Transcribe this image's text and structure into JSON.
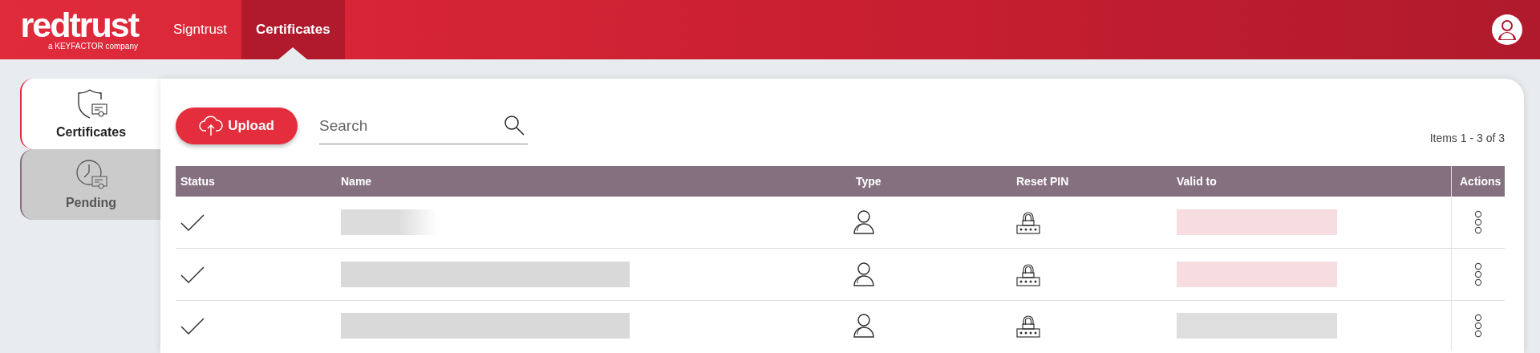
{
  "header": {
    "logo": "redtrust",
    "logo_tagline": "a KEYFACTOR company",
    "nav": [
      {
        "label": "Signtrust",
        "selected": false
      },
      {
        "label": "Certificates",
        "selected": true
      }
    ]
  },
  "side_tabs": [
    {
      "label": "Certificates",
      "kind": "certificates",
      "selected": true
    },
    {
      "label": "Pending",
      "kind": "pending",
      "selected": false
    }
  ],
  "toolbar": {
    "upload": "Upload",
    "search": {
      "placeholder": "Search"
    },
    "items_count": "Items 1 - 3 of 3"
  },
  "table": {
    "columns": [
      "Status",
      "Name",
      "Type",
      "Reset PIN",
      "Valid to",
      "Actions"
    ],
    "rows": [
      {
        "valid": true,
        "kind": "short",
        "color": "#f7dde0"
      },
      {
        "valid": true,
        "kind": "long",
        "color": "#f7dde0"
      },
      {
        "valid": true,
        "kind": "long",
        "color": "#dedede"
      }
    ]
  }
}
